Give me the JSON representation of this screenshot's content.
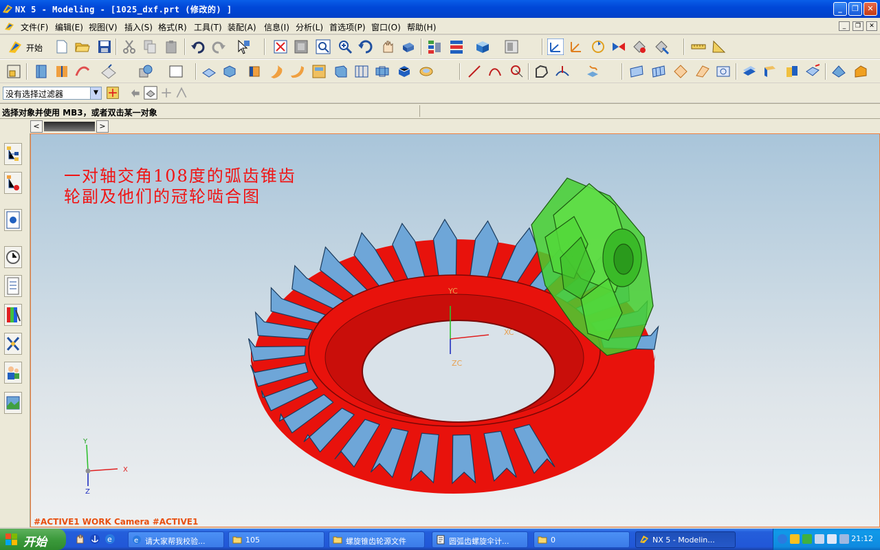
{
  "window": {
    "title": "NX 5 - Modeling - [1025_dxf.prt  (修改的) ]",
    "minimize": "_",
    "restore": "❐",
    "close": "✕"
  },
  "menubar": {
    "items": [
      "文件(F)",
      "编辑(E)",
      "视图(V)",
      "插入(S)",
      "格式(R)",
      "工具(T)",
      "装配(A)",
      "信息(I)",
      "分析(L)",
      "首选项(P)",
      "窗口(O)",
      "帮助(H)"
    ]
  },
  "toolbar": {
    "start_label": "开始",
    "selection_filter": "没有选择过滤器"
  },
  "cue_line": {
    "prompt": "选择对象并使用 MB3，或者双击某一对象"
  },
  "resource_strip": {
    "prev": "<",
    "next": ">"
  },
  "graphics": {
    "annotation_line1": "一对轴交角108度的弧齿锥齿",
    "annotation_line2": "轮副及他们的冠轮啮合图",
    "view_name": "#ACTIVE1 WORK Camera #ACTIVE1",
    "wcs_labels": {
      "x": "XC",
      "y": "YC",
      "z": "ZC"
    },
    "abs_labels": {
      "x": "X",
      "y": "Y",
      "z": "Z"
    },
    "colors": {
      "crown_body": "#e8120c",
      "crown_teeth": "#6ea6d8",
      "pinion": "#46d030"
    }
  },
  "taskbar": {
    "start_label": "开始",
    "tasks": [
      {
        "label": "请大家帮我校验...",
        "icon": "ie-icon"
      },
      {
        "label": "105",
        "icon": "folder-icon"
      },
      {
        "label": "螺旋锥齿轮源文件",
        "icon": "folder-icon"
      },
      {
        "label": "圆弧齿螺旋伞计...",
        "icon": "document-icon"
      },
      {
        "label": "0",
        "icon": "folder-icon"
      },
      {
        "label": "NX 5 - Modelin...",
        "icon": "nx-icon"
      }
    ],
    "clock": "21:12"
  }
}
